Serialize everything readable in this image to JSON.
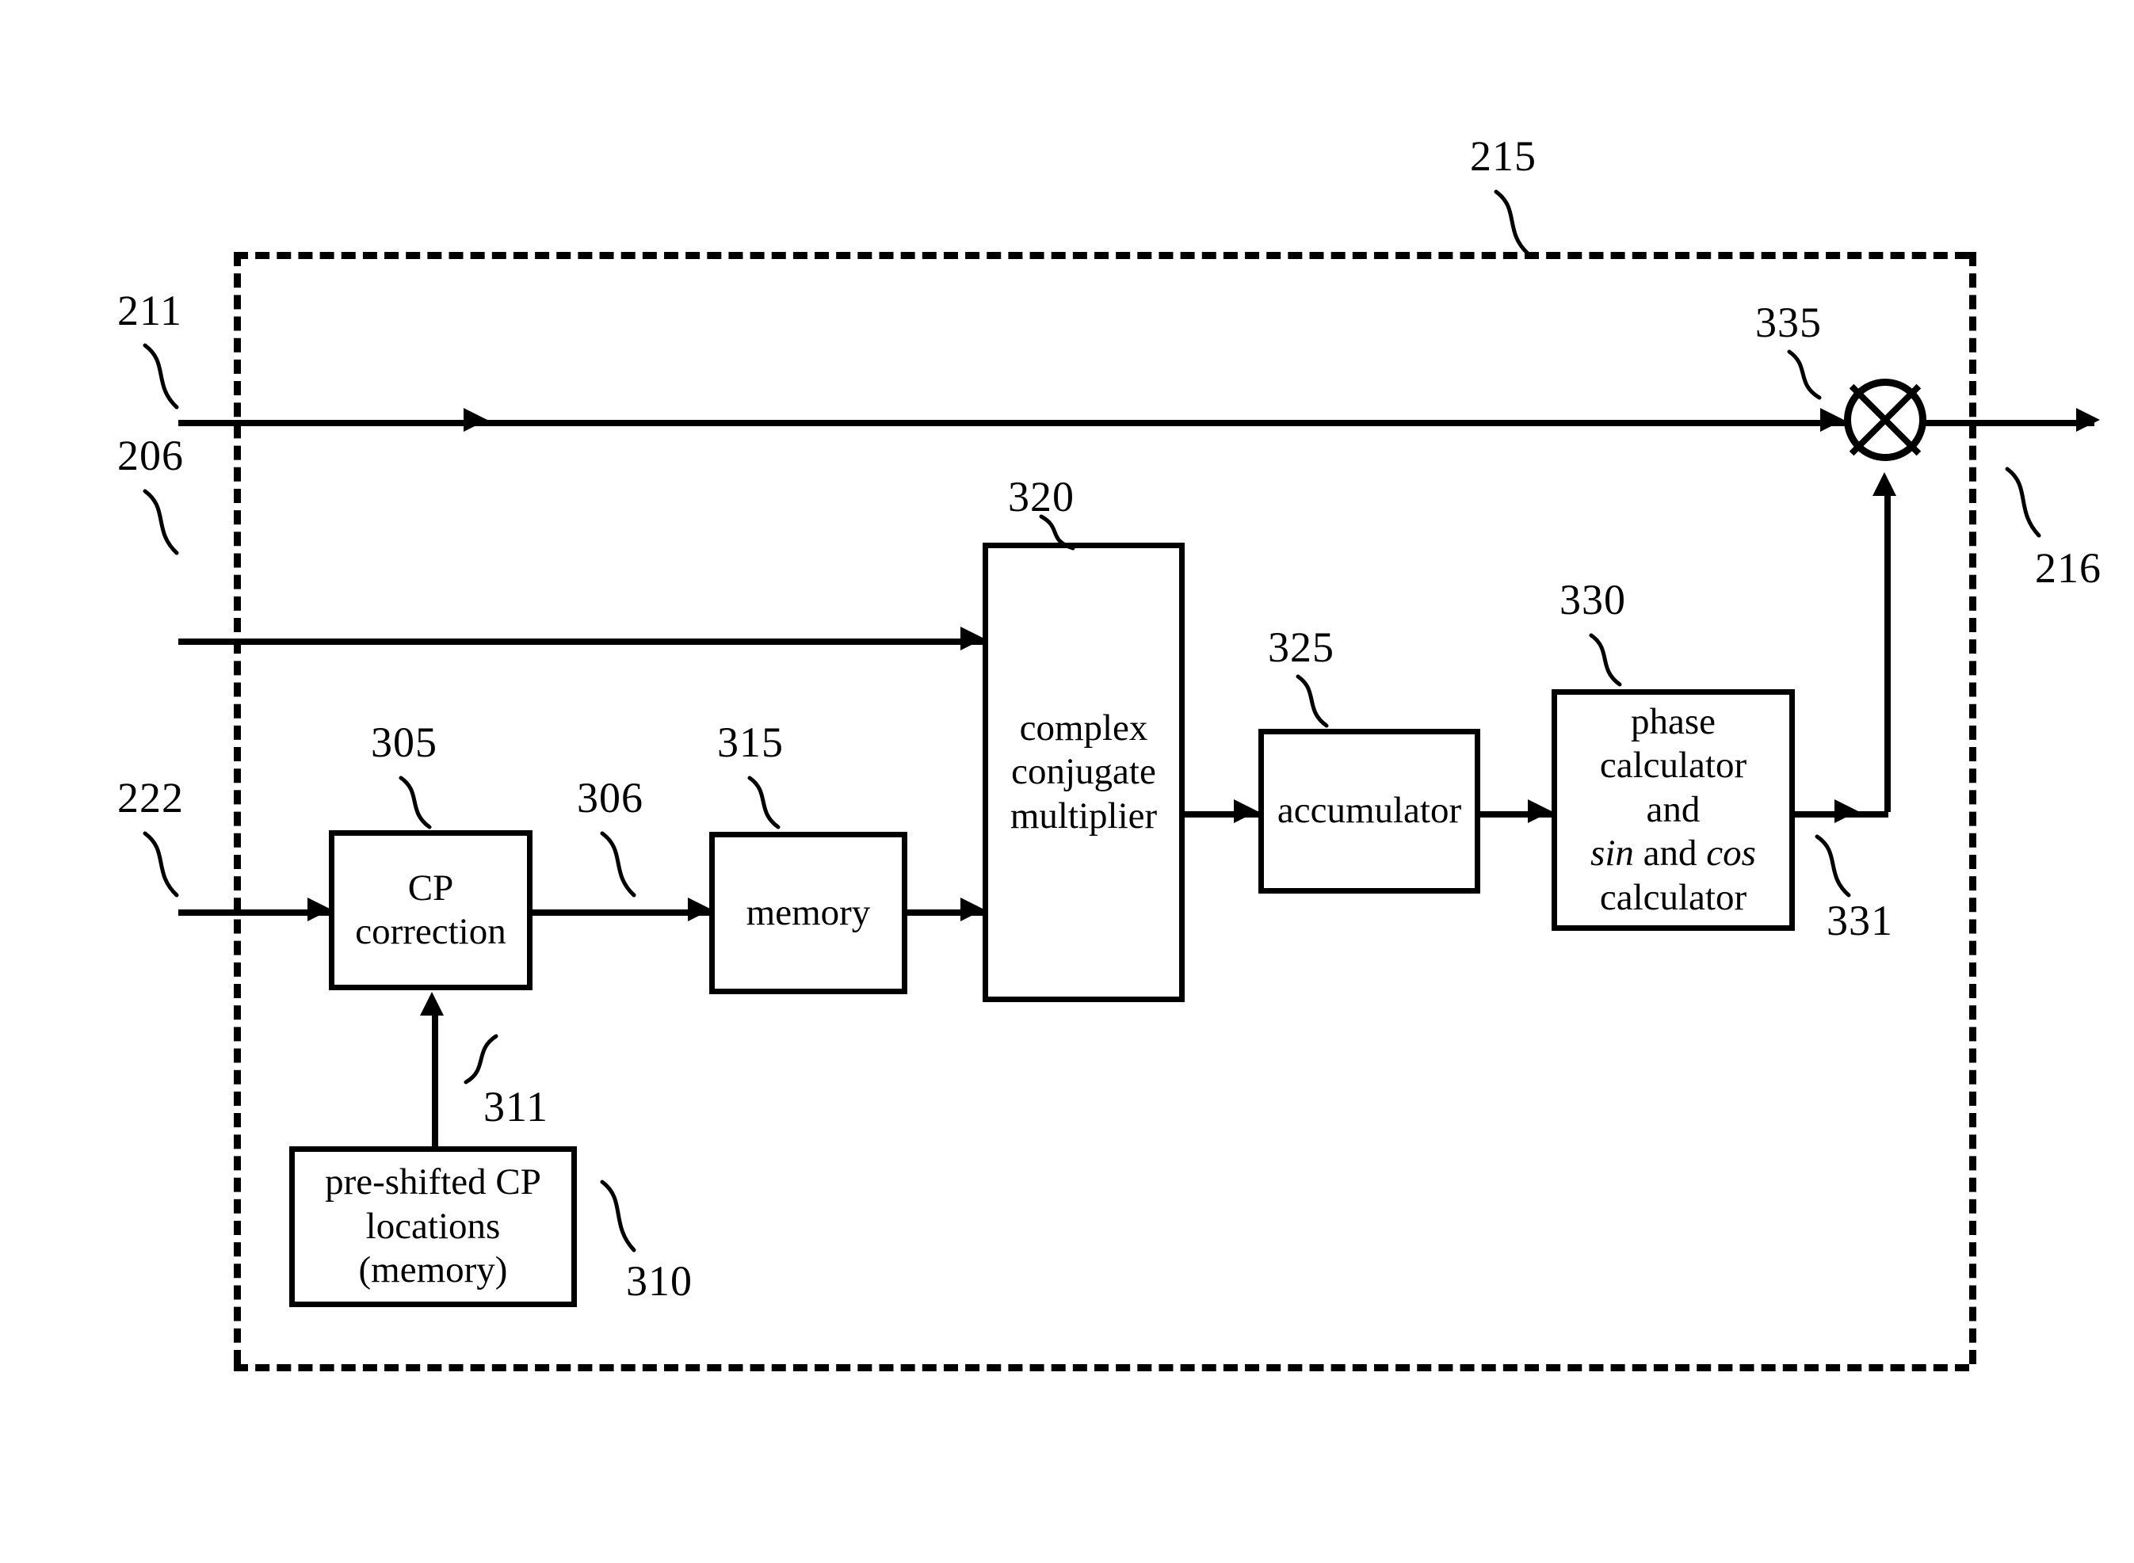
{
  "figure": {
    "type": "patent-block-diagram",
    "system_label": "215",
    "output_label": "216"
  },
  "blocks": [
    {
      "id": "305",
      "name": "cp-correction",
      "lines": [
        "CP",
        "correction"
      ]
    },
    {
      "id": "310",
      "name": "pre-shifted-cp-locations-memory",
      "lines": [
        "pre-shifted CP",
        "locations",
        "(memory)"
      ]
    },
    {
      "id": "315",
      "name": "memory",
      "lines": [
        "memory"
      ]
    },
    {
      "id": "320",
      "name": "complex-conjugate-multiplier",
      "lines": [
        "complex",
        "conjugate",
        "multiplier"
      ]
    },
    {
      "id": "325",
      "name": "accumulator",
      "lines": [
        "accumulator"
      ]
    },
    {
      "id": "330",
      "name": "phase-calculator-sin-cos-calculator",
      "lines": [
        "phase",
        "calculator",
        "and",
        "sin and cos",
        "calculator"
      ]
    },
    {
      "id": "335",
      "name": "complex-multiplier-node",
      "lines": []
    }
  ],
  "block_text": {
    "cp_correction_line1": "CP",
    "cp_correction_line2": "correction",
    "preshifted_line1": "pre-shifted CP",
    "preshifted_line2": "locations",
    "preshifted_line3": "(memory)",
    "memory": "memory",
    "ccm_line1": "complex",
    "ccm_line2": "conjugate",
    "ccm_line3": "multiplier",
    "accumulator": "accumulator",
    "phase_line1": "phase",
    "phase_line2": "calculator",
    "phase_line3": "and",
    "phase_line4_pre": "sin",
    "phase_line4_mid": " and ",
    "phase_line4_post": "cos",
    "phase_line5": "calculator"
  },
  "refs": {
    "r215": "215",
    "r211": "211",
    "r206": "206",
    "r222": "222",
    "r216": "216",
    "r305": "305",
    "r306": "306",
    "r310": "310",
    "r311": "311",
    "r315": "315",
    "r320": "320",
    "r325": "325",
    "r330": "330",
    "r331": "331",
    "r335": "335"
  },
  "colors": {
    "ink": "#000000",
    "paper": "#ffffff"
  }
}
